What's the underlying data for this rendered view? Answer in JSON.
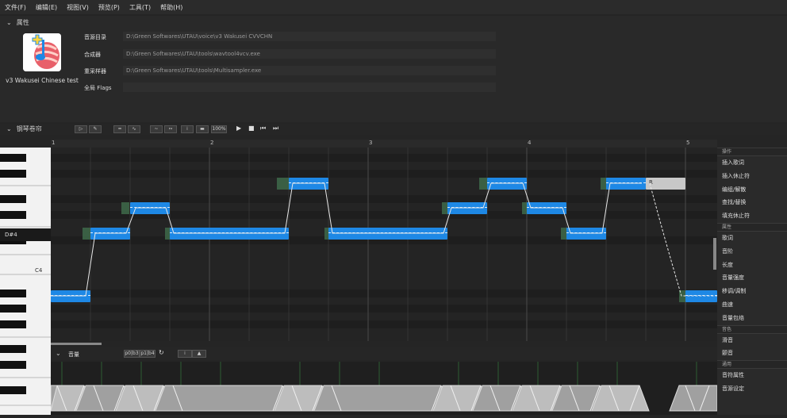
{
  "menu": [
    "文件(F)",
    "编辑(E)",
    "视图(V)",
    "预览(P)",
    "工具(T)",
    "帮助(H)"
  ],
  "properties": {
    "section_title": "属性",
    "singer_name": "v3 Wakusei Chinese test",
    "rows": [
      {
        "label": "音源目录",
        "value": "D:\\Green Softwares\\UTAU\\voice\\v3 Wakusei CVVCHN"
      },
      {
        "label": "合成器",
        "value": "D:\\Green Softwares\\UTAU\\tools\\wavtool4vcv.exe"
      },
      {
        "label": "重采样器",
        "value": "D:\\Green Softwares\\UTAU\\tools\\Multisampler.exe"
      },
      {
        "label": "全局 Flags",
        "value": ""
      }
    ]
  },
  "pianoroll": {
    "section_title": "钢琴卷帘",
    "zoom_label": "100%",
    "measures": [
      "1",
      "2",
      "3",
      "4",
      "5"
    ],
    "key_labels": [
      "D#4",
      "C4"
    ],
    "rest_note_label": "R"
  },
  "side_panel": {
    "groups": [
      {
        "header": "操作",
        "items": [
          "插入歌词",
          "插入休止符",
          "编组/解散",
          "查找/替换",
          "填充休止符"
        ]
      },
      {
        "header": "属性",
        "items": [
          "歌词",
          "音阶",
          "长度",
          "音量强度",
          "移调/调制",
          "曲速",
          "音量包络"
        ]
      },
      {
        "header": "音色",
        "items": [
          "滑音",
          "颤音"
        ]
      },
      {
        "header": "通用",
        "items": [
          "音符属性",
          "音源设定"
        ]
      }
    ]
  },
  "volume_panel": {
    "title": "音量",
    "buttons": [
      "p0|b3",
      "p1|b4"
    ]
  },
  "colors": {
    "note": "#1e88e5",
    "rest": "#c8c8c8",
    "accent": "#1e88e5"
  }
}
